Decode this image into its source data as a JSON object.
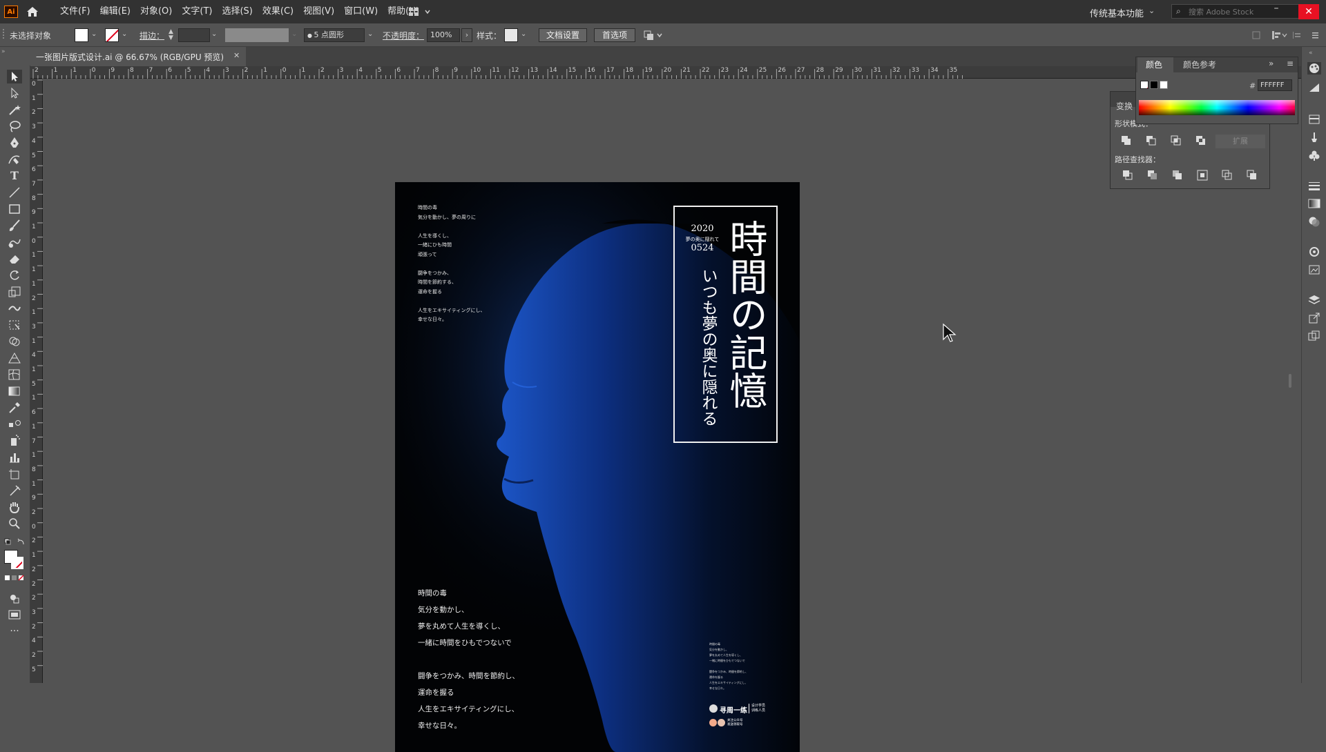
{
  "app": {
    "logo": "Ai",
    "menu": [
      "文件(F)",
      "编辑(E)",
      "对象(O)",
      "文字(T)",
      "选择(S)",
      "效果(C)",
      "视图(V)",
      "窗口(W)",
      "帮助(H)"
    ],
    "workspace": "传统基本功能",
    "search_placeholder": "搜索 Adobe Stock",
    "accent": "#ff7c00"
  },
  "control_bar": {
    "selection": "未选择对象",
    "stroke_label": "描边：",
    "brush": "5 点圆形",
    "opacity_label": "不透明度：",
    "opacity_value": "100%",
    "style_label": "样式：",
    "doc_setup": "文档设置",
    "prefs": "首选项"
  },
  "document": {
    "tab_title": "一张图片版式设计.ai @ 66.67% (RGB/GPU 预览)"
  },
  "rulers": {
    "top": [
      "2",
      "1",
      "1",
      "0",
      "9",
      "8",
      "7",
      "6",
      "5",
      "4",
      "3",
      "2",
      "1",
      "0",
      "1",
      "2",
      "3",
      "4",
      "5",
      "6",
      "7",
      "8",
      "9",
      "10",
      "11",
      "12",
      "13",
      "14",
      "15",
      "16",
      "17",
      "18",
      "19",
      "20",
      "21",
      "22",
      "23",
      "24",
      "25",
      "26",
      "27",
      "28",
      "29",
      "30",
      "31",
      "32",
      "33",
      "34",
      "35"
    ],
    "left": [
      "0",
      "1",
      "2",
      "3",
      "4",
      "5",
      "6",
      "7",
      "8",
      "9",
      "1",
      "0",
      "1",
      "1",
      "1",
      "2",
      "1",
      "3",
      "1",
      "4",
      "1",
      "5",
      "1",
      "6",
      "1",
      "7",
      "1",
      "8",
      "1",
      "9",
      "2",
      "0",
      "2",
      "1",
      "2",
      "2",
      "2",
      "3",
      "2",
      "4",
      "2",
      "5"
    ]
  },
  "poster": {
    "top_left_text": "時間の毒\n気分を動かし、夢の周りに\n\n人生を導くし、\n一緒にひも時間\n頑張って\n\n闘争をつかみ、\n時間を節約する、\n運命を握る\n\n人生をエキサイティングにし、\n幸せな日々。",
    "date_year": "2020",
    "date_sub": "夢の奥に隠れて",
    "date_day": "0524",
    "title": "時間の記憶",
    "subtitle": "いつも夢の奥に隠れる",
    "bottom_text": "時間の毒\n気分を動かし、\n夢を丸めて人生を導くし、\n一緒に時間をひもでつないで\n\n闘争をつかみ、時間を節約し、\n運命を握る\n人生をエキサイティングにし、\n幸せな日々。",
    "br_small_text": "時間の毒\n気分を動かし、\n夢を丸めて人生を導くし、\n一緒に時間をひもでつないで\n\n闘争をつかみ、時間を節約し、\n運命を握る\n人生をエキサイティングにし、\n幸せな日々。",
    "brand": "寻周一练",
    "brand_side": "设计学员\n训练人员",
    "brand_small": "关注公众号\n发送领取号"
  },
  "panels": {
    "color_tabs": [
      "颜色",
      "颜色参考"
    ],
    "hex_label": "#",
    "hex_value": "FFFFFF",
    "transform_tab": "变换",
    "shape_modes": "形状模式：",
    "expand": "扩展",
    "pathfinder": "路径查找器："
  }
}
